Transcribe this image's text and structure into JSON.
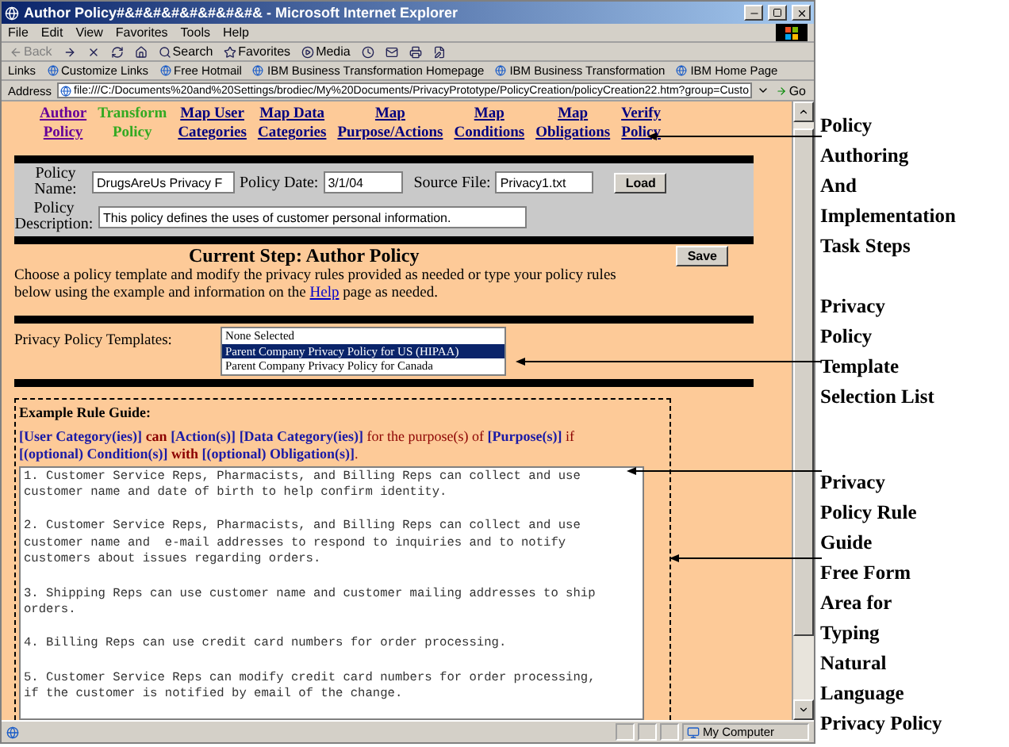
{
  "window": {
    "title": "Author Policy#&#&#&#&#&#&#&#& - Microsoft Internet Explorer",
    "menu": [
      "File",
      "Edit",
      "View",
      "Favorites",
      "Tools",
      "Help"
    ],
    "toolbar": [
      {
        "kind": "back",
        "label": "Back"
      },
      {
        "kind": "forward"
      },
      {
        "kind": "stop"
      },
      {
        "kind": "refresh"
      },
      {
        "kind": "home"
      },
      {
        "kind": "search",
        "label": "Search"
      },
      {
        "kind": "favorites",
        "label": "Favorites"
      },
      {
        "kind": "media",
        "label": "Media"
      },
      {
        "kind": "history"
      },
      {
        "kind": "mail"
      },
      {
        "kind": "print"
      },
      {
        "kind": "edit"
      }
    ],
    "links_label": "Links",
    "links": [
      "Customize Links",
      "Free Hotmail",
      "IBM Business Transformation Homepage",
      "IBM Business Transformation",
      "IBM Home Page"
    ],
    "address_label": "Address",
    "address": "file:///C:/Documents%20and%20Settings/brodiec/My%20Documents/PrivacyPrototype/PolicyCreation/policyCreation22.htm?group=Custo",
    "go": "Go",
    "status": "My Computer"
  },
  "steps": [
    {
      "lines": [
        "Author",
        "Policy"
      ],
      "kind": "visited"
    },
    {
      "lines": [
        "Transform",
        "Policy"
      ],
      "kind": "next"
    },
    {
      "lines": [
        "Map User",
        "Categories"
      ],
      "kind": "link"
    },
    {
      "lines": [
        "Map Data",
        "Categories"
      ],
      "kind": "link"
    },
    {
      "lines": [
        "Map",
        "Purpose/Actions"
      ],
      "kind": "link"
    },
    {
      "lines": [
        "Map",
        "Conditions"
      ],
      "kind": "link"
    },
    {
      "lines": [
        "Map",
        "Obligations"
      ],
      "kind": "link"
    },
    {
      "lines": [
        "Verify",
        "Policy"
      ],
      "kind": "link"
    }
  ],
  "form": {
    "name_label": "Policy Name:",
    "name_value": "DrugsAreUs Privacy F",
    "date_label": "Policy Date:",
    "date_value": "3/1/04",
    "source_label": "Source File:",
    "source_value": "Privacy1.txt",
    "load": "Load",
    "description_label": "Policy Description:",
    "description_value": "This policy defines the uses of customer personal information."
  },
  "current_step": "Current Step: Author Policy",
  "save": "Save",
  "instructions": {
    "before": "Choose a policy template and modify the privacy rules provided as needed or type your policy rules below using the example and information on the",
    "link": "Help",
    "after": "page as needed."
  },
  "templates": {
    "label": "Privacy Policy Templates:",
    "options": [
      {
        "label": "None Selected",
        "selected": false
      },
      {
        "label": "Parent Company Privacy Policy for US (HIPAA)",
        "selected": true
      },
      {
        "label": "Parent Company Privacy Policy for Canada",
        "selected": false
      }
    ]
  },
  "guide": {
    "title": "Example Rule Guide:",
    "segments": [
      {
        "text": "[User Category(ies)]",
        "kind": "slot"
      },
      {
        "text": " can ",
        "kind": "word"
      },
      {
        "text": "[Action(s)]",
        "kind": "slot"
      },
      {
        "text": " [Data Category(ies)]",
        "kind": "slot"
      },
      {
        "text": " for the purpose(s) of ",
        "kind": "plain"
      },
      {
        "text": "[Purpose(s)]",
        "kind": "slot"
      },
      {
        "text": " if ",
        "kind": "plain"
      },
      {
        "text": "[(optional) Condition(s)]",
        "kind": "slot"
      },
      {
        "text": " with ",
        "kind": "word"
      },
      {
        "text": "[(optional) Obligation(s)]",
        "kind": "slot"
      },
      {
        "text": ".",
        "kind": "plain"
      }
    ],
    "rules": "1. Customer Service Reps, Pharmacists, and Billing Reps can collect and use\ncustomer name and date of birth to help confirm identity.\n\n2. Customer Service Reps, Pharmacists, and Billing Reps can collect and use\ncustomer name and  e-mail addresses to respond to inquiries and to notify\ncustomers about issues regarding orders.\n\n3. Shipping Reps can use customer name and customer mailing addresses to ship\norders.\n\n4. Billing Reps can use credit card numbers for order processing.\n\n5. Customer Service Reps can modify credit card numbers for order processing,\nif the customer is notified by email of the change."
  },
  "annotations": [
    {
      "lines": [
        "Policy",
        "Authoring",
        "And",
        "Implementation",
        "Task Steps"
      ]
    },
    {
      "lines": [
        "Privacy",
        "Policy",
        "Template",
        "Selection List"
      ]
    },
    {
      "lines": [
        "Privacy",
        "Policy Rule",
        "Guide"
      ]
    },
    {
      "lines": [
        "Free Form",
        "Area for",
        "Typing",
        "Natural",
        "Language",
        "Privacy Policy"
      ]
    }
  ]
}
